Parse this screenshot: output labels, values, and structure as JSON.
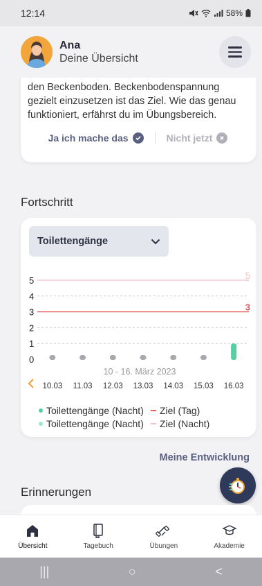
{
  "status": {
    "time": "12:14",
    "battery": "58%"
  },
  "header": {
    "name": "Ana",
    "subtitle": "Deine Übersicht"
  },
  "tip_card": {
    "text": "den Beckenboden. Beckenbodenspannung gezielt einzusetzen ist das Ziel. Wie das genau funktioniert, erfährst du im Übungsbereich.",
    "yes_label": "Ja ich mache das",
    "no_label": "Nicht jetzt"
  },
  "progress": {
    "section_title": "Fortschritt",
    "dropdown_value": "Toilettengänge",
    "date_range": "10 - 16. März 2023",
    "legend": [
      {
        "label": "Toilettengänge (Nacht)",
        "color": "#55d0a0"
      },
      {
        "label": "Ziel (Tag)",
        "color": "#e06060"
      },
      {
        "label": "Toilettengänge (Nacht)",
        "color": "#9ee6cc"
      },
      {
        "label": "Ziel (Nacht)",
        "color": "#f3c1c1"
      }
    ],
    "link": "Meine Entwicklung"
  },
  "chart_data": {
    "type": "bar",
    "categories": [
      "10.03",
      "11.03",
      "12.03",
      "13.03",
      "14.03",
      "15.03",
      "16.03"
    ],
    "series": [
      {
        "name": "Toilettengänge (Nacht)",
        "values": [
          0,
          0,
          0,
          0,
          0,
          0,
          1
        ],
        "color": "#55d0a0"
      }
    ],
    "goal_lines": [
      {
        "name": "Ziel (Tag)",
        "value": 3,
        "label": "3",
        "color": "#e06060"
      },
      {
        "name": "Ziel (Nacht)",
        "value": 5,
        "label": "5",
        "color": "#f3c1c1"
      }
    ],
    "yticks": [
      "0",
      "1",
      "2",
      "3",
      "4",
      "5"
    ],
    "ylim": [
      0,
      5
    ],
    "grid": true
  },
  "reminders": {
    "section_title": "Erinnerungen"
  },
  "nav": [
    {
      "label": "Übersicht",
      "icon": "home-icon"
    },
    {
      "label": "Tagebuch",
      "icon": "book-icon"
    },
    {
      "label": "Übungen",
      "icon": "dumbbell-icon"
    },
    {
      "label": "Akademie",
      "icon": "graduation-cap-icon"
    }
  ],
  "android_nav": {
    "recents": "|||",
    "home": "○",
    "back": "<"
  },
  "colors": {
    "accent": "#5a6080",
    "navy": "#2f3a5a",
    "bar": "#55d0a0",
    "goal_day": "#e06060",
    "goal_night": "#f3c1c1"
  }
}
